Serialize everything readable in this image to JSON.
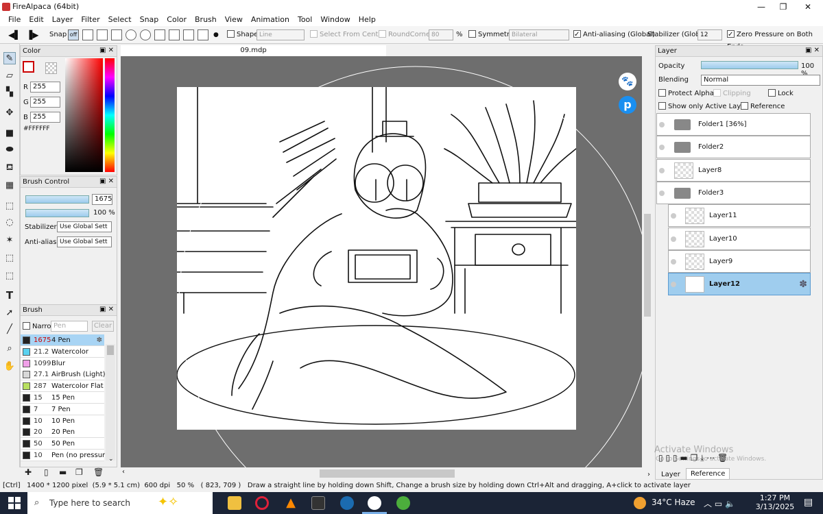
{
  "window": {
    "title": "FireAlpaca (64bit)",
    "controls": [
      "—",
      "❐",
      "✕"
    ]
  },
  "menu": [
    "File",
    "Edit",
    "Layer",
    "Filter",
    "Select",
    "Snap",
    "Color",
    "Brush",
    "View",
    "Animation",
    "Tool",
    "Window",
    "Help"
  ],
  "toolbar": {
    "snap_label": "Snap",
    "snap_off": "off",
    "shape_label": "Shape",
    "shape_value": "Line",
    "select_from_center": "Select From Center",
    "round_corner": "RoundCorner",
    "round_corner_value": "80",
    "percent": "%",
    "symmetry": "Symmetry",
    "symmetry_value": "Bilateral",
    "antialias": "Anti-aliasing (Global)",
    "stabilizer": "Stabilizer (Global)",
    "stabilizer_value": "12",
    "zero_pressure": "Zero Pressure on Both Ends"
  },
  "color_panel": {
    "title": "Color",
    "r_label": "R",
    "r": "255",
    "g_label": "G",
    "g": "255",
    "b_label": "B",
    "b": "255",
    "hex": "#FFFFFF"
  },
  "brush_control": {
    "title": "Brush Control",
    "size": "1675",
    "opacity": "100 %",
    "stabilizer_label": "Stabilizer",
    "stabilizer_value": "Use Global Sett",
    "antialias_label": "Anti-aliasir",
    "antialias_value": "Use Global Sett"
  },
  "brush_panel": {
    "title": "Brush",
    "narrow_label": "Narro",
    "narrow_placeholder": "Pen",
    "clear": "Clear",
    "items": [
      {
        "size": "1675",
        "name": "4 Pen",
        "color": "#222222",
        "selected": true
      },
      {
        "size": "21.2",
        "name": "Watercolor",
        "color": "#5ad2f0"
      },
      {
        "size": "1099",
        "name": "Blur",
        "color": "#f0a0e8"
      },
      {
        "size": "27.1",
        "name": "AirBrush (Light)",
        "color": "#d8d8d8"
      },
      {
        "size": "287",
        "name": "Watercolor Flat Br",
        "color": "#b8e060"
      },
      {
        "size": "15",
        "name": "15 Pen",
        "color": "#222222"
      },
      {
        "size": "7",
        "name": "7 Pen",
        "color": "#222222"
      },
      {
        "size": "10",
        "name": "10 Pen",
        "color": "#222222"
      },
      {
        "size": "20",
        "name": "20 Pen",
        "color": "#222222"
      },
      {
        "size": "50",
        "name": "50 Pen",
        "color": "#222222"
      },
      {
        "size": "10",
        "name": "Pen (no pressure)",
        "color": "#222222"
      }
    ]
  },
  "document": {
    "tab": "09.mdp"
  },
  "layer_panel": {
    "title": "Layer",
    "opacity_label": "Opacity",
    "opacity": "100 %",
    "blending_label": "Blending",
    "blending": "Normal",
    "protect_alpha": "Protect Alpha",
    "clipping": "Clipping",
    "lock": "Lock",
    "show_only_active": "Show only Active Layer",
    "reference": "Reference",
    "layers": [
      {
        "name": "Folder1 [36%]",
        "kind": "folder"
      },
      {
        "name": "Folder2",
        "kind": "folder"
      },
      {
        "name": "Layer8",
        "kind": "layer"
      },
      {
        "name": "Folder3",
        "kind": "folder"
      },
      {
        "name": "Layer11",
        "kind": "layer",
        "indent": true
      },
      {
        "name": "Layer10",
        "kind": "layer",
        "indent": true
      },
      {
        "name": "Layer9",
        "kind": "layer",
        "indent": true
      },
      {
        "name": "Layer12",
        "kind": "layer",
        "indent": true,
        "selected": true
      }
    ],
    "tabs": [
      "Layer",
      "Reference"
    ],
    "watermark": "Activate Windows",
    "watermark_sub": "Go to Settings to activate Windows."
  },
  "status": {
    "ctrl": "[Ctrl]",
    "size": "1400 * 1200 pixel",
    "cm": "(5.9 * 5.1 cm)",
    "dpi": "600 dpi",
    "zoom": "50 %",
    "coords": "( 823, 709 )",
    "hint": "Draw a straight line by holding down Shift, Change a brush size by holding down Ctrl+Alt and dragging, A+click to activate layer"
  },
  "taskbar": {
    "search_placeholder": "Type here to search",
    "weather": "34°C  Haze",
    "time": "1:27 PM",
    "date": "3/13/2025"
  }
}
